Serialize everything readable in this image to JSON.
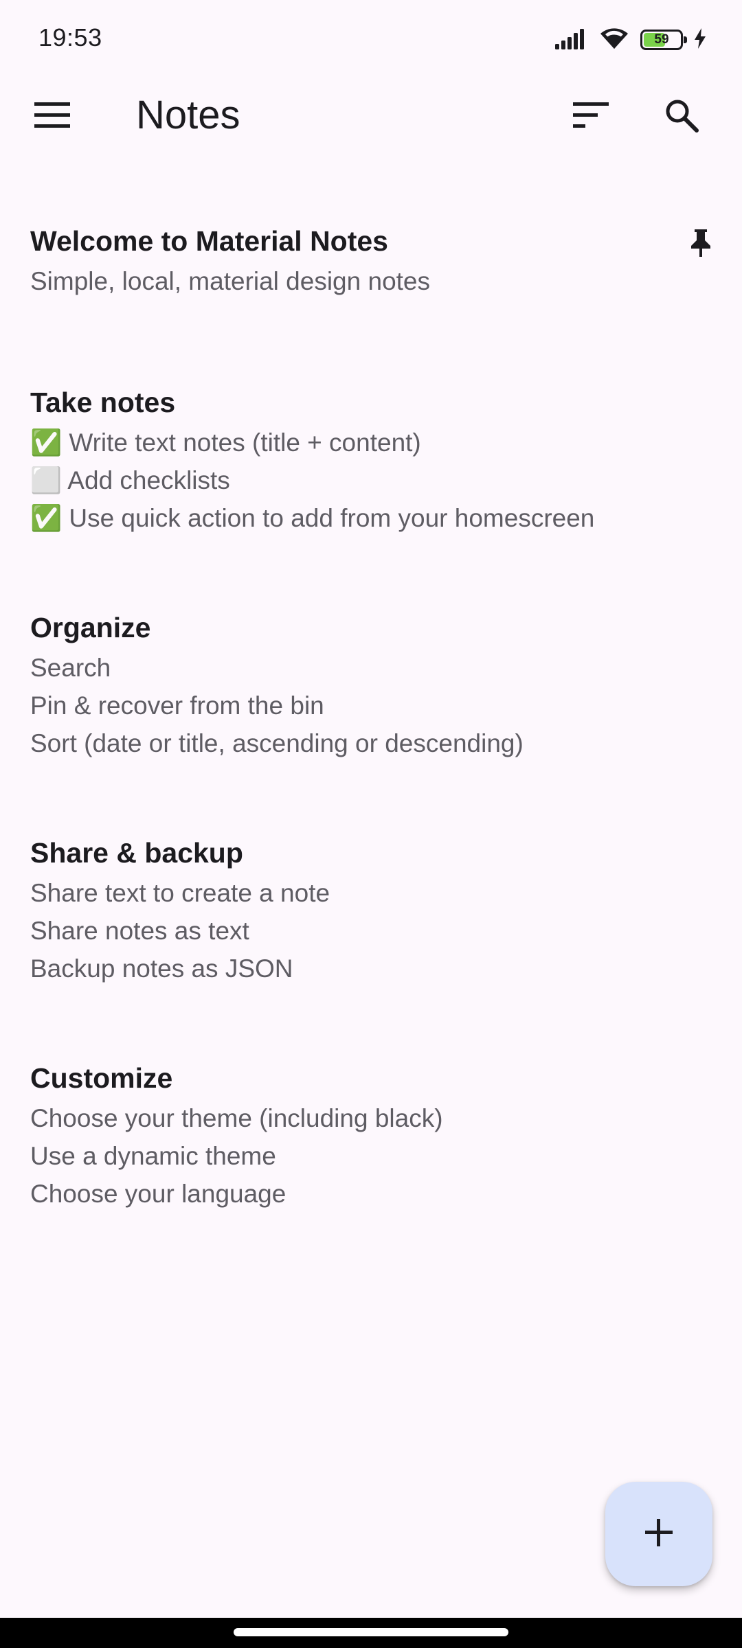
{
  "status": {
    "time": "19:53",
    "battery_level": "59",
    "battery_fraction": 0.59,
    "icons": [
      "signal-icon",
      "wifi-icon",
      "battery-icon",
      "charging-bolt-icon"
    ]
  },
  "appbar": {
    "title": "Notes",
    "icons": [
      "menu-icon",
      "sort-icon",
      "search-icon"
    ]
  },
  "notes": [
    {
      "title": "Welcome to Material Notes",
      "content": "Simple, local, material design notes",
      "pinned": true
    },
    {
      "title": "Take notes",
      "content": "✅ Write text notes (title + content)\n⬜ Add checklists\n✅ Use quick action to add from your homescreen",
      "pinned": false
    },
    {
      "title": "Organize",
      "content": "Search\nPin & recover from the bin\nSort (date or title, ascending or descending)",
      "pinned": false
    },
    {
      "title": "Share & backup",
      "content": "Share text to create a note\nShare notes as text\nBackup notes as JSON",
      "pinned": false
    },
    {
      "title": "Customize",
      "content": "Choose your theme (including black)\nUse a dynamic theme\nChoose your language",
      "pinned": false
    }
  ],
  "fab": {
    "icon": "plus-icon"
  },
  "colors": {
    "background": "#fdf8fd",
    "fab": "#d8e2fb",
    "title_text": "#1c1b1f",
    "body_text": "#5e5c63",
    "battery_fill": "#7ad24a"
  }
}
